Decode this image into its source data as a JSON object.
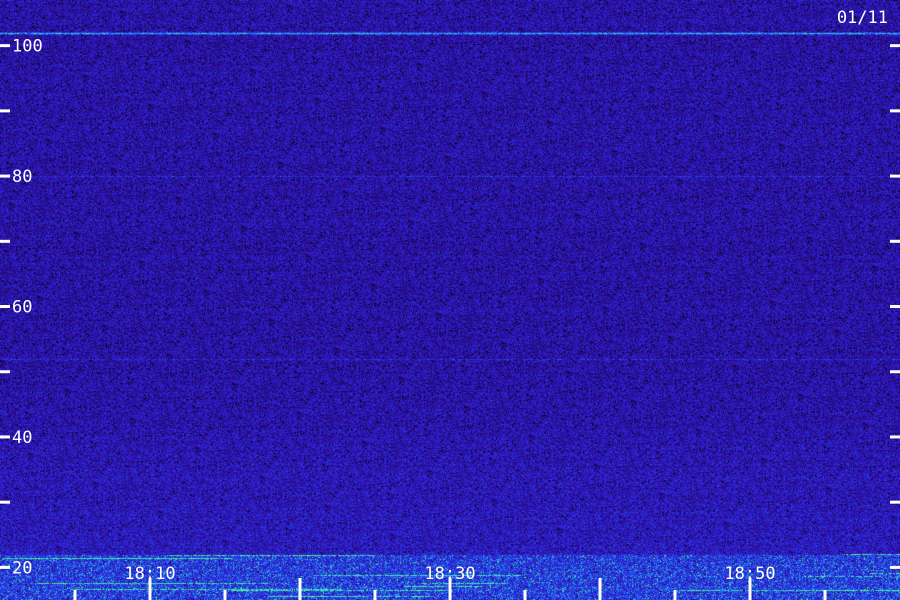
{
  "chart_data": {
    "type": "heatmap",
    "title": "",
    "date": "01/11",
    "xlabel": "",
    "ylabel": "",
    "x_ticks": [
      "18:10",
      "18:30",
      "18:50"
    ],
    "x_range": [
      "18:00",
      "19:00"
    ],
    "y_ticks": [
      20,
      40,
      60,
      80,
      100
    ],
    "y_range": [
      15,
      107
    ],
    "y_minor_ticks": [
      30,
      50,
      70,
      90
    ],
    "colormap": [
      "#000000",
      "#1a0860",
      "#3310b0",
      "#2a2ee6",
      "#1f7cf2",
      "#2fd6e6",
      "#5cff5c"
    ],
    "background_color": "#2a0c6e",
    "bright_lines_y": [
      102
    ],
    "faint_lines_y": [
      80,
      52
    ],
    "intense_band_y": [
      15,
      22
    ]
  }
}
